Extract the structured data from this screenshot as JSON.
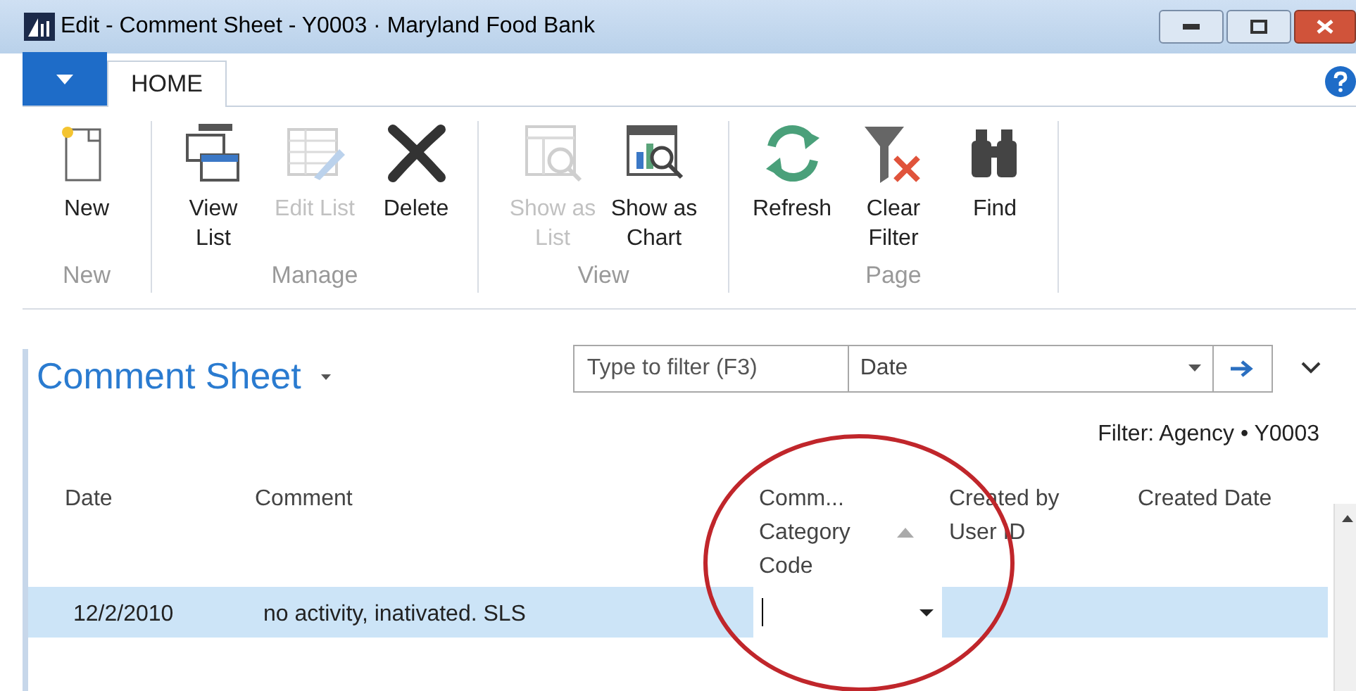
{
  "window": {
    "title": "Edit - Comment Sheet - Y0003 · Maryland Food Bank"
  },
  "tabs": [
    {
      "label": "HOME",
      "selected": true
    }
  ],
  "ribbon": {
    "groups": [
      {
        "label": "New",
        "buttons": [
          {
            "kind": "new",
            "label": "New",
            "disabled": false
          }
        ]
      },
      {
        "label": "Manage",
        "buttons": [
          {
            "kind": "view-list",
            "label": "View List",
            "disabled": false
          },
          {
            "kind": "edit-list",
            "label": "Edit List",
            "disabled": true
          },
          {
            "kind": "delete",
            "label": "Delete",
            "disabled": false
          }
        ]
      },
      {
        "label": "View",
        "buttons": [
          {
            "kind": "show-list",
            "label": "Show as List",
            "disabled": true
          },
          {
            "kind": "show-chart",
            "label": "Show as Chart",
            "disabled": false
          }
        ]
      },
      {
        "label": "Page",
        "buttons": [
          {
            "kind": "refresh",
            "label": "Refresh",
            "disabled": false
          },
          {
            "kind": "clear-filter",
            "label": "Clear Filter",
            "disabled": false
          },
          {
            "kind": "find",
            "label": "Find",
            "disabled": false
          }
        ]
      }
    ]
  },
  "page": {
    "title": "Comment Sheet",
    "filter_placeholder": "Type to filter (F3)",
    "filter_field": "Date",
    "filter_info": "Filter: Agency • Y0003"
  },
  "table": {
    "columns": [
      {
        "label": "Date",
        "sorted": false
      },
      {
        "label": "Comment",
        "sorted": false
      },
      {
        "label": "Comm... Category Code",
        "sorted": true
      },
      {
        "label": "Created by User ID",
        "sorted": false
      },
      {
        "label": "Created Date",
        "sorted": false
      }
    ],
    "rows": [
      {
        "selected": true,
        "cells": [
          "12/2/2010",
          "no activity, inativated. SLS",
          "",
          "",
          ""
        ]
      }
    ]
  }
}
